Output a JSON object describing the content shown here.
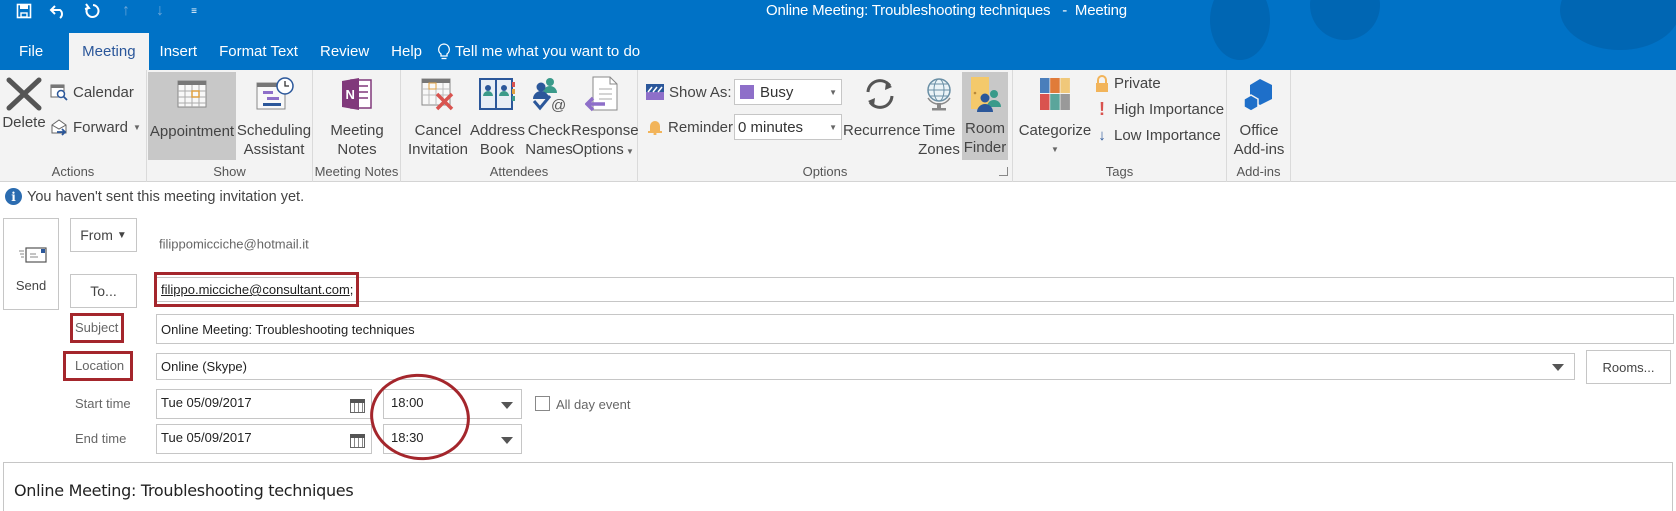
{
  "window": {
    "title": "Online Meeting: Troubleshooting techniques   -  Meeting"
  },
  "quick_access": [
    {
      "icon": "save-icon"
    },
    {
      "icon": "undo-icon"
    },
    {
      "icon": "redo-icon"
    },
    {
      "icon": "previous-item-icon"
    },
    {
      "icon": "next-item-icon"
    },
    {
      "icon": "customize-qat-icon"
    }
  ],
  "tabs": [
    {
      "label": "File"
    },
    {
      "label": "Meeting",
      "active": true
    },
    {
      "label": "Insert"
    },
    {
      "label": "Format Text"
    },
    {
      "label": "Review"
    },
    {
      "label": "Help"
    }
  ],
  "tell_me": "Tell me what you want to do",
  "ribbon": {
    "actions": {
      "label": "Actions",
      "delete": "Delete",
      "calendar": "Calendar",
      "forward": "Forward"
    },
    "show": {
      "label": "Show",
      "appointment": "Appointment",
      "scheduling_1": "Scheduling",
      "scheduling_2": "Assistant"
    },
    "meeting_notes": {
      "label": "Meeting Notes",
      "btn_1": "Meeting",
      "btn_2": "Notes"
    },
    "attendees": {
      "label": "Attendees",
      "cancel_1": "Cancel",
      "cancel_2": "Invitation",
      "address_1": "Address",
      "address_2": "Book",
      "check_1": "Check",
      "check_2": "Names",
      "response_1": "Response",
      "response_2": "Options"
    },
    "options": {
      "label": "Options",
      "show_as_label": "Show As:",
      "show_as_value": "Busy",
      "show_as_color": "#8e6fc9",
      "reminder_label": "Reminder:",
      "reminder_value": "0 minutes",
      "recurrence": "Recurrence",
      "time_zones_1": "Time",
      "time_zones_2": "Zones",
      "room_finder_1": "Room",
      "room_finder_2": "Finder"
    },
    "tags": {
      "label": "Tags",
      "categorize": "Categorize",
      "private": "Private",
      "high": "High Importance",
      "low": "Low Importance"
    },
    "addins": {
      "label": "Add-ins",
      "office_1": "Office",
      "office_2": "Add-ins"
    }
  },
  "form": {
    "info": "You haven't sent this meeting invitation yet.",
    "send": "Send",
    "from_btn": "From",
    "from_value": "filippomicciche@hotmail.it",
    "to_btn": "To...",
    "to_value": "filippo.micciche@consultant.com",
    "to_suffix": ";",
    "subject_label": "Subject",
    "subject_value": "Online Meeting: Troubleshooting techniques",
    "location_label": "Location",
    "location_value": "Online (Skype)",
    "rooms_btn": "Rooms...",
    "start_label": "Start time",
    "start_date": "Tue 05/09/2017",
    "start_time": "18:00",
    "all_day": "All day event",
    "all_day_checked": false,
    "end_label": "End time",
    "end_date": "Tue 05/09/2017",
    "end_time": "18:30",
    "body_text": "Online Meeting: Troubleshooting techniques"
  },
  "colors": {
    "accent": "#0072c6",
    "ribbon_bg": "#f3f3f3",
    "annotation_red": "#a4262c"
  }
}
